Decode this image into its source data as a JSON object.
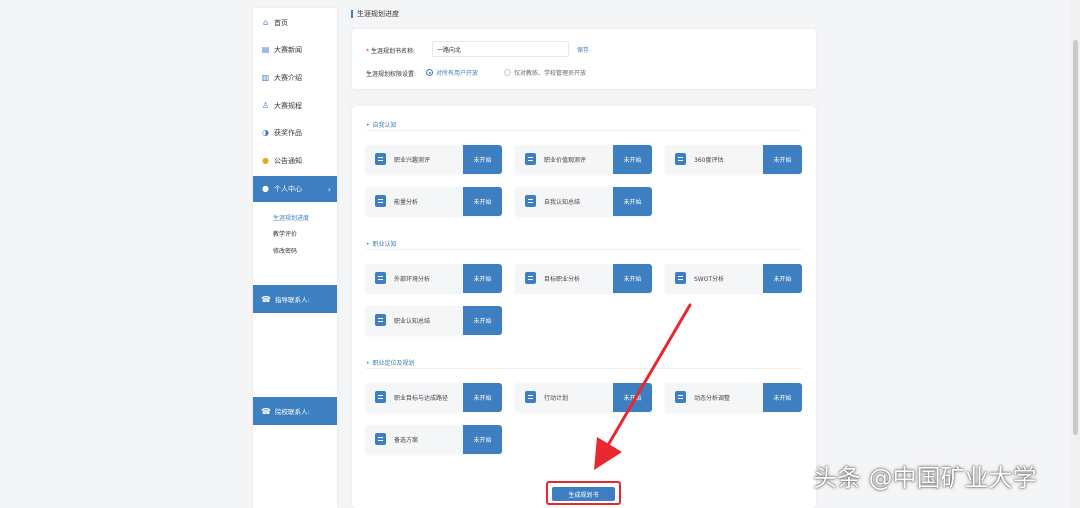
{
  "sidebar": {
    "nav": [
      {
        "label": "首页",
        "icon": "home-icon"
      },
      {
        "label": "大赛新闻",
        "icon": "news-icon"
      },
      {
        "label": "大赛介绍",
        "icon": "book-icon"
      },
      {
        "label": "大赛规程",
        "icon": "medal-icon"
      },
      {
        "label": "获奖作品",
        "icon": "award-icon"
      },
      {
        "label": "公告通知",
        "icon": "bell-icon"
      },
      {
        "label": "个人中心",
        "icon": "user-icon",
        "active": true
      }
    ],
    "sub_items": [
      "生涯规划进度",
      "教学评价",
      "修改密码"
    ],
    "contact_teacher": "指导联系人:",
    "contact_school": "院校联系人:"
  },
  "page_heading": "生涯规划进度",
  "settings": {
    "name_label": "生涯规划书名称:",
    "name_value": "一路向北",
    "save_label": "保存",
    "permission_label": "生涯规划权限设置:",
    "option_all": "对所有用户开放",
    "option_limited": "仅对教练、学校管理员开放"
  },
  "sections": [
    {
      "title": "自我认知",
      "steps": [
        {
          "name": "职业兴趣测评",
          "status": "未开始"
        },
        {
          "name": "职业价值观测评",
          "status": "未开始"
        },
        {
          "name": "360度评估",
          "status": "未开始"
        },
        {
          "name": "能量分析",
          "status": "未开始"
        },
        {
          "name": "自我认知总结",
          "status": "未开始"
        }
      ]
    },
    {
      "title": "职业认知",
      "steps": [
        {
          "name": "外部环境分析",
          "status": "未开始"
        },
        {
          "name": "目标职业分析",
          "status": "未开始"
        },
        {
          "name": "SWOT分析",
          "status": "未开始"
        },
        {
          "name": "职业认知总结",
          "status": "未开始"
        }
      ]
    },
    {
      "title": "职业定位及规划",
      "steps": [
        {
          "name": "职业目标与达成路径",
          "status": "未开始"
        },
        {
          "name": "行动计划",
          "status": "未开始"
        },
        {
          "name": "动态分析调整",
          "status": "未开始"
        },
        {
          "name": "备选方案",
          "status": "未开始"
        }
      ]
    }
  ],
  "generate_label": "生成规划书",
  "watermark": "头条 @中国矿业大学",
  "colors": {
    "accent": "#3d7fc1",
    "highlight": "#e8282e"
  }
}
